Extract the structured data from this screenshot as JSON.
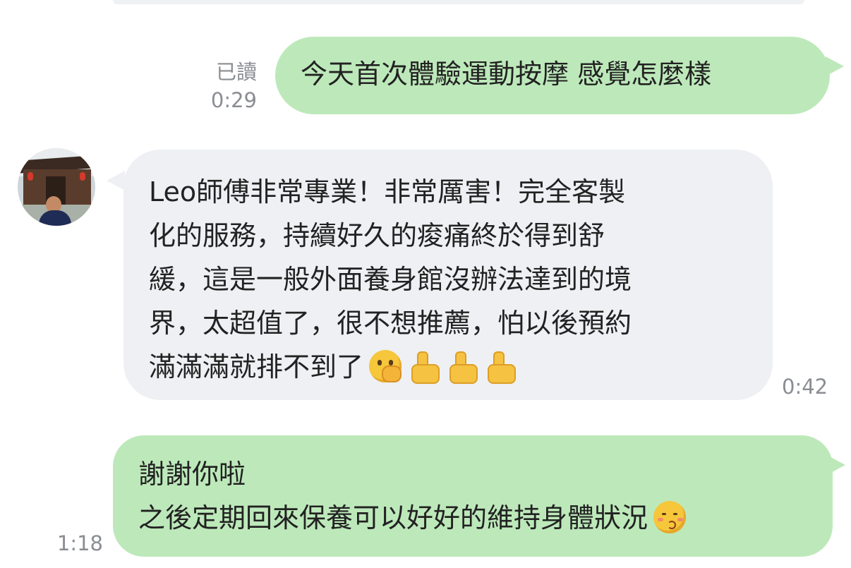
{
  "messages": [
    {
      "direction": "outgoing",
      "read_status": "已讀",
      "time": "0:29",
      "lines": [
        "今天首次體驗運動按摩 感覺怎麼樣"
      ]
    },
    {
      "direction": "incoming",
      "time": "0:42",
      "lines": [
        "Leo師傅非常專業！非常厲害！完全客製",
        "化的服務，持續好久的痠痛終於得到舒",
        "緩，這是一般外面養身館沒辦法達到的境",
        "界，太超值了，很不想推薦，怕以後預約",
        "滿滿滿就排不到了"
      ],
      "emojis": [
        "face-with-hand-over-mouth",
        "thumbs-up",
        "thumbs-up",
        "thumbs-up"
      ]
    },
    {
      "direction": "outgoing",
      "time": "1:18",
      "lines": [
        "謝謝你啦",
        "之後定期回來保養可以好好的維持身體狀況"
      ],
      "emojis": [
        "kissing-face-with-smiling-eyes"
      ]
    }
  ],
  "colors": {
    "outgoing_bubble": "#bde9ba",
    "incoming_bubble": "#eef0f3",
    "meta_text": "#8a8d92",
    "background": "#ffffff"
  }
}
